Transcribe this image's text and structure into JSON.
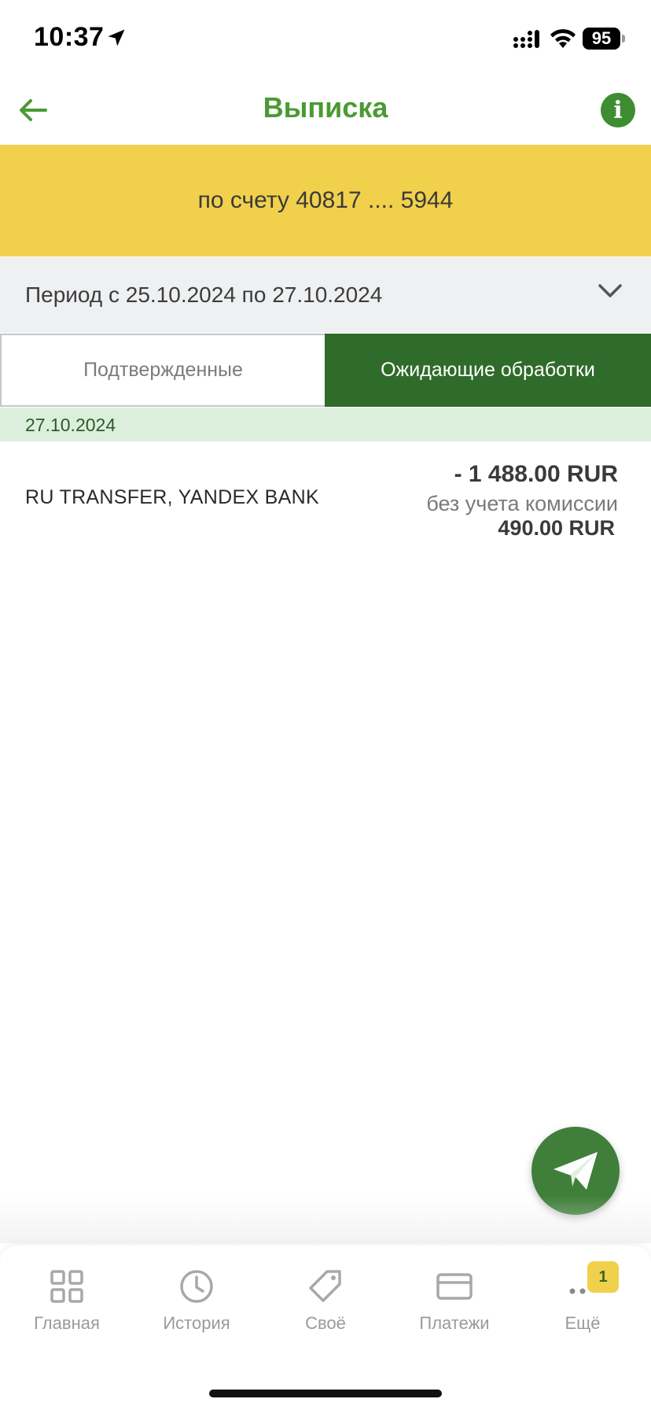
{
  "status_bar": {
    "time": "10:37",
    "battery": "95"
  },
  "header": {
    "title": "Выписка",
    "info_label": "i"
  },
  "account": {
    "text": "по счету 40817 .... 5944"
  },
  "period": {
    "text": "Период с 25.10.2024 по 27.10.2024"
  },
  "tabs": [
    {
      "label": "Подтвержденные",
      "active": false
    },
    {
      "label": "Ожидающие обработки",
      "active": true
    }
  ],
  "groups": [
    {
      "date": "27.10.2024",
      "transactions": [
        {
          "name": "RU TRANSFER, YANDEX BANK",
          "amount": "- 1 488.00 RUR",
          "commission_label": "без учета комиссии",
          "commission_amount": "490.00 RUR"
        }
      ]
    }
  ],
  "bottom_nav": {
    "items": [
      {
        "label": "Главная",
        "icon": "grid-icon"
      },
      {
        "label": "История",
        "icon": "clock-icon"
      },
      {
        "label": "Своё",
        "icon": "tag-icon"
      },
      {
        "label": "Платежи",
        "icon": "card-icon"
      },
      {
        "label": "Ещё",
        "icon": "more-icon"
      }
    ],
    "badge": "1"
  },
  "colors": {
    "accent_green": "#4a9a33",
    "dark_green": "#2f6b2a",
    "banner_yellow": "#f1d04c"
  }
}
